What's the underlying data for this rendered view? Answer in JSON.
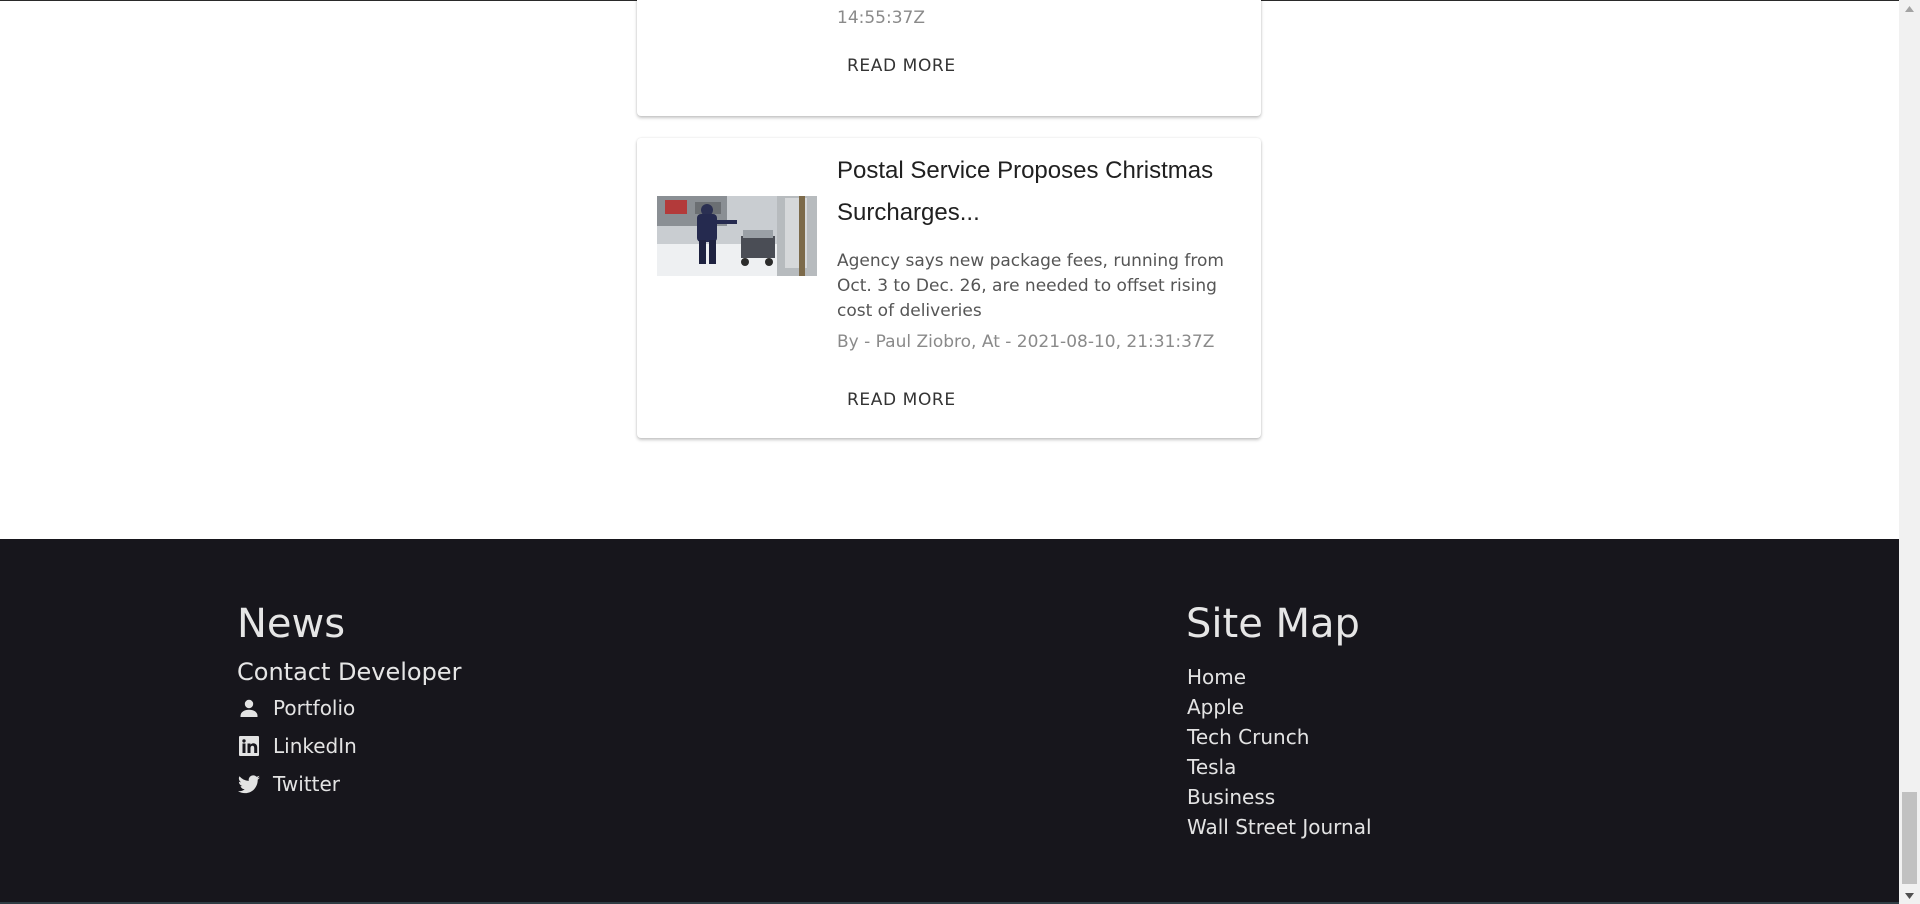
{
  "articles": [
    {
      "meta": "14:55:37Z",
      "read_more": "READ MORE"
    },
    {
      "title": "Postal Service Proposes Christmas Surcharges...",
      "description": "Agency says new package fees, running from Oct. 3 to Dec. 26, are needed to offset rising cost of deliveries",
      "meta": "By - Paul Ziobro, At - 2021-08-10, 21:31:37Z",
      "read_more": "READ MORE"
    }
  ],
  "footer": {
    "brand": "News",
    "contact_heading": "Contact Developer",
    "contact_links": [
      {
        "label": "Portfolio",
        "icon": "person-icon"
      },
      {
        "label": "LinkedIn",
        "icon": "linkedin-icon"
      },
      {
        "label": "Twitter",
        "icon": "twitter-icon"
      }
    ],
    "sitemap_heading": "Site Map",
    "sitemap_links": [
      "Home",
      "Apple",
      "Tech Crunch",
      "Tesla",
      "Business",
      "Wall Street Journal"
    ]
  },
  "colors": {
    "footer_bg": "#17161c",
    "card_bg": "#ffffff"
  }
}
